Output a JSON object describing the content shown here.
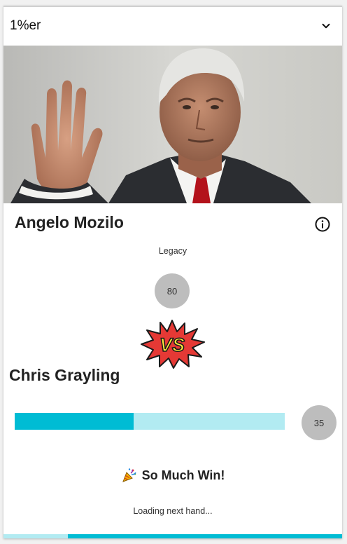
{
  "header": {
    "title": "1%er",
    "icon": "chevron-down-icon"
  },
  "card": {
    "name": "Angelo Mozilo",
    "category": "Legacy",
    "score": "80",
    "info_icon": "info-icon"
  },
  "vs": {
    "text": "VS"
  },
  "opponent": {
    "name": "Chris Grayling",
    "score": "35",
    "bar_fill_fraction": 0.44
  },
  "result": {
    "icon": "party-popper-icon",
    "text": "So Much Win!"
  },
  "status": {
    "text": "Loading next hand...",
    "progress_fraction": 0.81
  },
  "colors": {
    "accent": "#00bcd4",
    "accent_light": "#b2ebf2",
    "score_circle": "#bdbdbd",
    "vs_red": "#e53935",
    "vs_yellow": "#ffeb3b"
  }
}
